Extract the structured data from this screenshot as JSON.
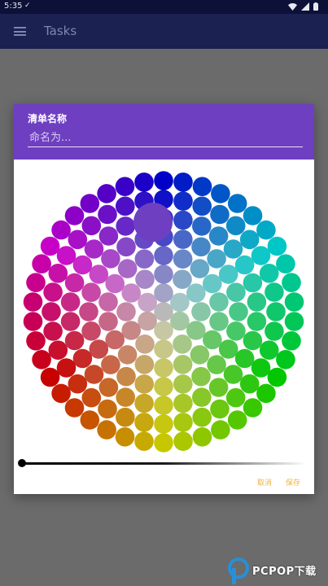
{
  "status_bar": {
    "time": "5:35",
    "check": "✓"
  },
  "app_bar": {
    "title": "Tasks",
    "menu_icon": "hamburger-menu-icon"
  },
  "dialog": {
    "title": "清单名称",
    "name_placeholder": "命名为...",
    "cancel_label": "取消",
    "save_label": "保存",
    "accent_color": "#6e3fc1",
    "action_color": "#f2b33a"
  },
  "color_wheel": {
    "selected_color": "#6e3fc1",
    "brightness": 0.0
  },
  "watermark": {
    "text": "PCPOP下载"
  }
}
